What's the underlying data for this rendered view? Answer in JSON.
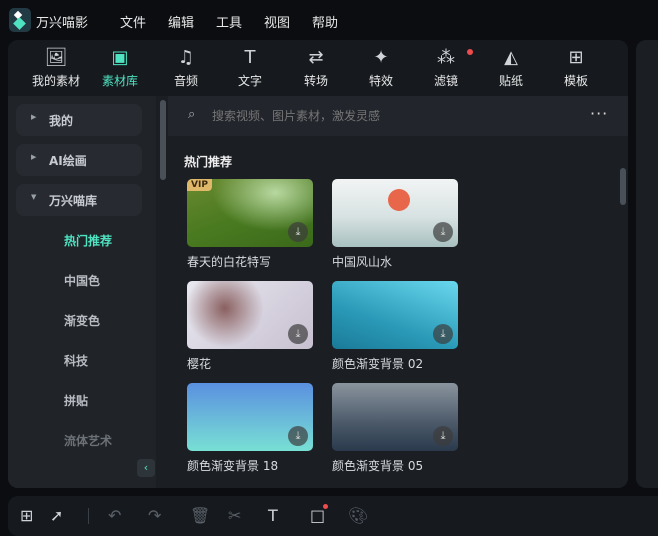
{
  "app": {
    "name": "万兴喵影",
    "menu": [
      "文件",
      "编辑",
      "工具",
      "视图",
      "帮助"
    ]
  },
  "tabs": [
    {
      "label": "我的素材",
      "icon": "image-icon"
    },
    {
      "label": "素材库",
      "icon": "cloud-folder-icon",
      "active": true
    },
    {
      "label": "音频",
      "icon": "music-note-icon"
    },
    {
      "label": "文字",
      "icon": "text-icon"
    },
    {
      "label": "转场",
      "icon": "transition-icon"
    },
    {
      "label": "特效",
      "icon": "sparkle-star-icon"
    },
    {
      "label": "滤镜",
      "icon": "filter-icon",
      "badge": true
    },
    {
      "label": "贴纸",
      "icon": "sticker-icon"
    },
    {
      "label": "模板",
      "icon": "template-icon"
    }
  ],
  "sidebar": {
    "groups": [
      {
        "label": "我的",
        "expanded": false
      },
      {
        "label": "AI绘画",
        "expanded": false
      },
      {
        "label": "万兴喵库",
        "expanded": true
      }
    ],
    "subitems": [
      {
        "label": "热门推荐",
        "active": true
      },
      {
        "label": "中国色"
      },
      {
        "label": "渐变色"
      },
      {
        "label": "科技"
      },
      {
        "label": "拼贴"
      },
      {
        "label": "流体艺术"
      }
    ]
  },
  "search": {
    "placeholder": "搜索视频、图片素材，激发灵感"
  },
  "section_title": "热门推荐",
  "items": [
    {
      "title": "春天的白花特写",
      "vip": "VIP"
    },
    {
      "title": "中国风山水"
    },
    {
      "title": "樱花"
    },
    {
      "title": "颜色渐变背景 02"
    },
    {
      "title": "颜色渐变背景 18"
    },
    {
      "title": "颜色渐变背景 05"
    }
  ],
  "colors": {
    "accent": "#4fe3c1",
    "badge": "#ee4c4c"
  }
}
